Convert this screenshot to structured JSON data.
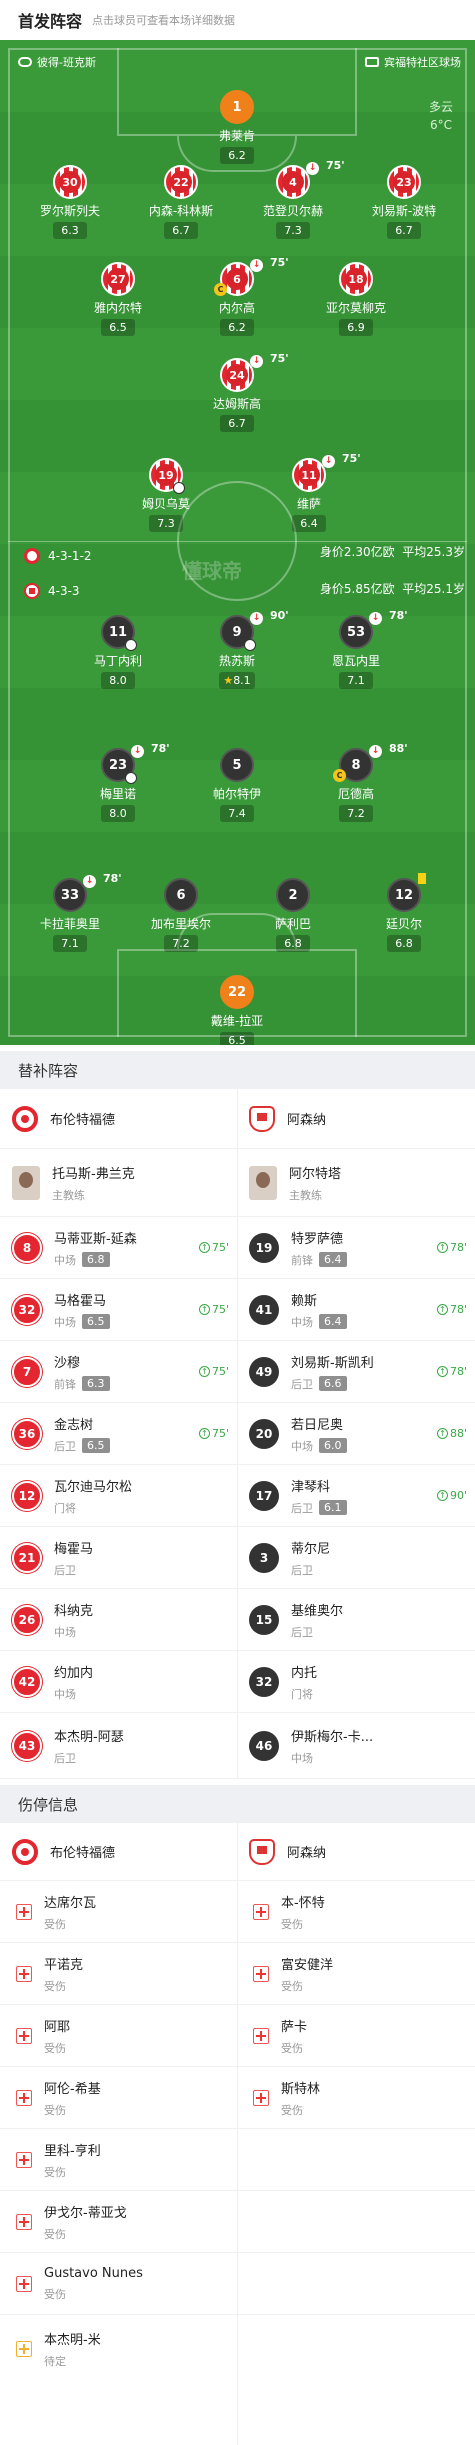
{
  "header": {
    "title": "首发阵容",
    "subtitle": "点击球员可查看本场详细数据"
  },
  "pitch": {
    "home_venue": "彼得-班克斯",
    "away_venue": "宾福特社区球场",
    "weather": "多云",
    "temperature": "6°C",
    "watermark": "懂球帝",
    "home_formation": "4-3-1-2",
    "home_value": "身价2.30亿欧",
    "home_age": "平均25.3岁",
    "away_formation": "4-3-3",
    "away_value": "身价5.85亿欧",
    "away_age": "平均25.1岁",
    "home_players": [
      {
        "num": "1",
        "name": "弗莱肯",
        "rating": "6.2"
      },
      {
        "num": "30",
        "name": "罗尔斯列夫",
        "rating": "6.3"
      },
      {
        "num": "22",
        "name": "内森-科林斯",
        "rating": "6.7"
      },
      {
        "num": "4",
        "name": "范登贝尔赫",
        "rating": "7.3",
        "sub": "75'"
      },
      {
        "num": "23",
        "name": "刘易斯-波特",
        "rating": "6.7"
      },
      {
        "num": "27",
        "name": "雅内尔特",
        "rating": "6.5"
      },
      {
        "num": "6",
        "name": "内尔高",
        "rating": "6.2",
        "sub": "75'"
      },
      {
        "num": "18",
        "name": "亚尔莫柳克",
        "rating": "6.9"
      },
      {
        "num": "24",
        "name": "达姆斯高",
        "rating": "6.7",
        "sub": "75'"
      },
      {
        "num": "19",
        "name": "姆贝乌莫",
        "rating": "7.3"
      },
      {
        "num": "11",
        "name": "维萨",
        "rating": "6.4",
        "sub": "75'"
      }
    ],
    "away_players": [
      {
        "num": "11",
        "name": "马丁内利",
        "rating": "8.0"
      },
      {
        "num": "9",
        "name": "热苏斯",
        "rating": "8.1",
        "sub": "90'"
      },
      {
        "num": "53",
        "name": "恩瓦内里",
        "rating": "7.1",
        "sub": "78'"
      },
      {
        "num": "23",
        "name": "梅里诺",
        "rating": "8.0",
        "sub": "78'"
      },
      {
        "num": "5",
        "name": "帕尔特伊",
        "rating": "7.4"
      },
      {
        "num": "8",
        "name": "厄德高",
        "rating": "7.2",
        "sub": "88'"
      },
      {
        "num": "33",
        "name": "卡拉菲奥里",
        "rating": "7.1",
        "sub": "78'"
      },
      {
        "num": "6",
        "name": "加布里埃尔",
        "rating": "7.2"
      },
      {
        "num": "2",
        "name": "萨利巴",
        "rating": "6.8"
      },
      {
        "num": "12",
        "name": "廷贝尔",
        "rating": "6.8"
      },
      {
        "num": "22",
        "name": "戴维-拉亚",
        "rating": "6.5"
      }
    ]
  },
  "subs": {
    "title": "替补阵容",
    "home_team": "布伦特福德",
    "away_team": "阿森纳",
    "home_coach": {
      "name": "托马斯-弗兰克",
      "role": "主教练"
    },
    "away_coach": {
      "name": "阿尔特塔",
      "role": "主教练"
    },
    "rows": [
      {
        "h": {
          "num": "8",
          "name": "马蒂亚斯-延森",
          "pos": "中场",
          "rating": "6.8",
          "in": "75'"
        },
        "a": {
          "num": "19",
          "name": "特罗萨德",
          "pos": "前锋",
          "rating": "6.4",
          "in": "78'"
        }
      },
      {
        "h": {
          "num": "32",
          "name": "马格霍马",
          "pos": "中场",
          "rating": "6.5",
          "in": "75'"
        },
        "a": {
          "num": "41",
          "name": "赖斯",
          "pos": "中场",
          "rating": "6.4",
          "in": "78'"
        }
      },
      {
        "h": {
          "num": "7",
          "name": "沙穆",
          "pos": "前锋",
          "rating": "6.3",
          "in": "75'"
        },
        "a": {
          "num": "49",
          "name": "刘易斯-斯凯利",
          "pos": "后卫",
          "rating": "6.6",
          "in": "78'"
        }
      },
      {
        "h": {
          "num": "36",
          "name": "金志树",
          "pos": "后卫",
          "rating": "6.5",
          "in": "75'"
        },
        "a": {
          "num": "20",
          "name": "若日尼奥",
          "pos": "中场",
          "rating": "6.0",
          "in": "88'"
        }
      },
      {
        "h": {
          "num": "12",
          "name": "瓦尔迪马尔松",
          "pos": "门将"
        },
        "a": {
          "num": "17",
          "name": "津琴科",
          "pos": "后卫",
          "rating": "6.1",
          "in": "90'"
        }
      },
      {
        "h": {
          "num": "21",
          "name": "梅霍马",
          "pos": "后卫"
        },
        "a": {
          "num": "3",
          "name": "蒂尔尼",
          "pos": "后卫"
        }
      },
      {
        "h": {
          "num": "26",
          "name": "科纳克",
          "pos": "中场"
        },
        "a": {
          "num": "15",
          "name": "基维奥尔",
          "pos": "后卫"
        }
      },
      {
        "h": {
          "num": "42",
          "name": "约加内",
          "pos": "中场"
        },
        "a": {
          "num": "32",
          "name": "内托",
          "pos": "门将"
        }
      },
      {
        "h": {
          "num": "43",
          "name": "本杰明-阿瑟",
          "pos": "后卫"
        },
        "a": {
          "num": "46",
          "name": "伊斯梅尔-卡...",
          "pos": "中场"
        }
      }
    ]
  },
  "injuries": {
    "title": "伤停信息",
    "home_team": "布伦特福德",
    "away_team": "阿森纳",
    "home": [
      {
        "name": "达席尔瓦",
        "status": "受伤"
      },
      {
        "name": "平诺克",
        "status": "受伤"
      },
      {
        "name": "阿耶",
        "status": "受伤"
      },
      {
        "name": "阿伦-希基",
        "status": "受伤"
      },
      {
        "name": "里科-亨利",
        "status": "受伤"
      },
      {
        "name": "伊戈尔-蒂亚戈",
        "status": "受伤"
      },
      {
        "name": "Gustavo Nunes",
        "status": "受伤"
      },
      {
        "name": "本杰明-米",
        "status": "待定"
      }
    ],
    "away": [
      {
        "name": "本-怀特",
        "status": "受伤"
      },
      {
        "name": "富安健洋",
        "status": "受伤"
      },
      {
        "name": "萨卡",
        "status": "受伤"
      },
      {
        "name": "斯特林",
        "status": "受伤"
      }
    ]
  },
  "colors": {
    "home": "#e3262f",
    "away": "#333333",
    "pitch": "#3a9a3a",
    "sub_in": "#39a845"
  }
}
